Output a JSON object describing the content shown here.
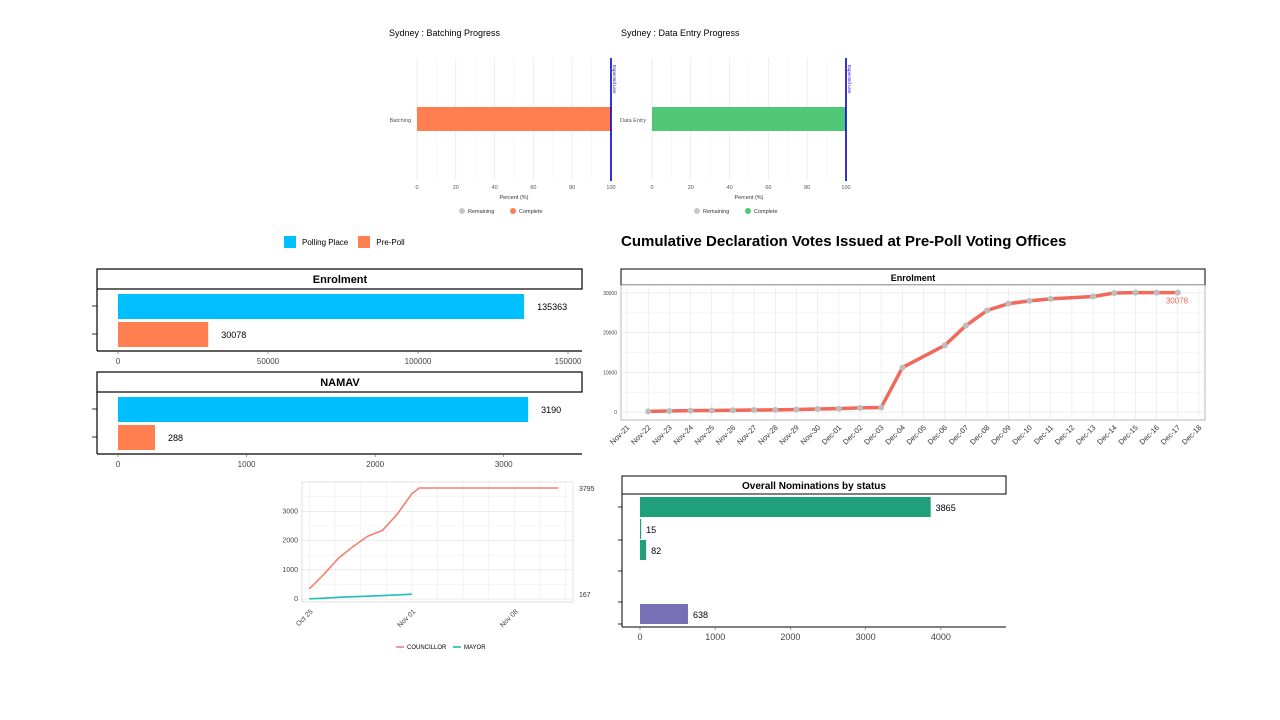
{
  "colors": {
    "complete_batching": "#FF7F50",
    "complete_entry": "#50C878",
    "remaining": "#C8C8C8",
    "expected_line": "#0000CC",
    "polling": "#00BFFF",
    "prepoll": "#FF7F50",
    "line_red": "#F0695A",
    "councillor": "#F08070",
    "mayor": "#20BDB9",
    "nom_green": "#1FA07A",
    "nom_purple": "#7770B5"
  },
  "header_legend": {
    "polling": "Polling Place",
    "prepoll": "Pre-Poll"
  },
  "chart_data": [
    {
      "id": "batching",
      "type": "bar",
      "title": "Sydney : Batching Progress",
      "categories": [
        "Batching"
      ],
      "values": [
        100
      ],
      "xlabel": "Percent (%)",
      "xlim": [
        0,
        100
      ],
      "xticks": [
        "0",
        "20",
        "40",
        "60",
        "80",
        "100"
      ],
      "expected_line": {
        "value": 100,
        "label": "Expected Line"
      },
      "legend": [
        "Remaining",
        "Complete"
      ]
    },
    {
      "id": "dataentry",
      "type": "bar",
      "title": "Sydney : Data Entry Progress",
      "categories": [
        "Data Entry"
      ],
      "values": [
        100
      ],
      "xlabel": "Percent (%)",
      "xlim": [
        0,
        100
      ],
      "xticks": [
        "0",
        "20",
        "40",
        "60",
        "80",
        "100"
      ],
      "expected_line": {
        "value": 100,
        "label": "Expected Line"
      },
      "legend": [
        "Remaining",
        "Complete"
      ]
    },
    {
      "id": "enrolment",
      "type": "bar",
      "panel_title": "Enrolment",
      "series": [
        {
          "name": "Polling Place",
          "values": [
            135363
          ]
        },
        {
          "name": "Pre-Poll",
          "values": [
            30078
          ]
        }
      ],
      "labels": [
        "135363",
        "30078"
      ],
      "xlim": [
        0,
        150000
      ],
      "xticks": [
        "0",
        "50000",
        "100000",
        "150000"
      ]
    },
    {
      "id": "namav",
      "type": "bar",
      "panel_title": "NAMAV",
      "series": [
        {
          "name": "Polling Place",
          "values": [
            3190
          ]
        },
        {
          "name": "Pre-Poll",
          "values": [
            288
          ]
        }
      ],
      "labels": [
        "3190",
        "288"
      ],
      "xlim": [
        0,
        3500
      ],
      "xticks": [
        "0",
        "1000",
        "2000",
        "3000"
      ]
    },
    {
      "id": "cumulative",
      "type": "line",
      "title": "Cumulative Declaration Votes Issued at Pre-Poll Voting Offices",
      "panel_title": "Enrolment",
      "x": [
        "Nov-22",
        "Nov-23",
        "Nov-24",
        "Nov-25",
        "Nov-26",
        "Nov-27",
        "Nov-28",
        "Nov-29",
        "Nov-30",
        "Dec-01",
        "Dec-02",
        "Dec-03",
        "Dec-04",
        "Dec-06",
        "Dec-07",
        "Dec-08",
        "Dec-09",
        "Dec-10",
        "Dec-11",
        "Dec-13",
        "Dec-14",
        "Dec-15",
        "Dec-16",
        "Dec-17"
      ],
      "y": [
        150,
        250,
        350,
        400,
        450,
        500,
        550,
        650,
        750,
        850,
        1050,
        1150,
        11200,
        16800,
        21800,
        25600,
        27300,
        28000,
        28500,
        29100,
        30000,
        30100,
        30078,
        30078
      ],
      "xtick_labels": [
        "Nov-21",
        "Nov-22",
        "Nov-23",
        "Nov-24",
        "Nov-25",
        "Nov-26",
        "Nov-27",
        "Nov-28",
        "Nov-29",
        "Nov-30",
        "Dec-01",
        "Dec-02",
        "Dec-03",
        "Dec-04",
        "Dec-05",
        "Dec-06",
        "Dec-07",
        "Dec-08",
        "Dec-09",
        "Dec-10",
        "Dec-11",
        "Dec-12",
        "Dec-13",
        "Dec-14",
        "Dec-15",
        "Dec-16",
        "Dec-17",
        "Dec-18"
      ],
      "yticks": [
        "0",
        "10000",
        "20000",
        "30000"
      ],
      "ylim": [
        -1000,
        31000
      ],
      "end_label": "30078"
    },
    {
      "id": "nominations_time",
      "type": "line",
      "series": [
        {
          "name": "COUNCILLOR",
          "x": [
            0,
            2,
            4,
            6,
            8,
            10,
            12,
            14,
            15,
            16,
            17,
            18,
            26,
            34
          ],
          "y": [
            350,
            850,
            1400,
            1800,
            2150,
            2350,
            2900,
            3600,
            3795,
            3795,
            3795,
            3795,
            3795,
            3795
          ]
        },
        {
          "name": "MAYOR",
          "x": [
            0,
            2,
            4,
            6,
            8,
            10,
            12,
            14
          ],
          "y": [
            10,
            30,
            60,
            80,
            100,
            120,
            140,
            167
          ]
        }
      ],
      "xlim": [
        -1,
        36
      ],
      "ylim": [
        -100,
        4000
      ],
      "xtick_labels": [
        "Oct 25",
        "Nov 01",
        "Nov 08"
      ],
      "yticks": [
        "0",
        "1000",
        "2000",
        "3000"
      ],
      "end_labels": [
        "3795",
        "167"
      ]
    },
    {
      "id": "nominations_status",
      "type": "bar",
      "panel_title": "Overall Nominations by status",
      "values": [
        3865,
        15,
        82,
        638
      ],
      "labels": [
        "3865",
        "15",
        "82",
        "638"
      ],
      "xlim": [
        0,
        4800
      ],
      "xticks": [
        "0",
        "1000",
        "2000",
        "3000",
        "4000"
      ]
    }
  ]
}
